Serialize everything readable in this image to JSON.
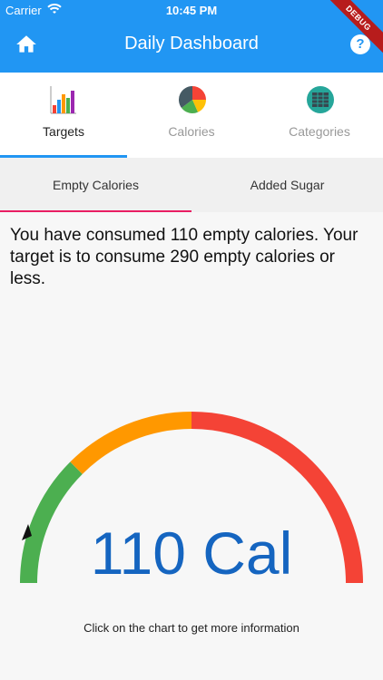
{
  "status": {
    "carrier": "Carrier",
    "time": "10:45 PM",
    "debug": "DEBUG"
  },
  "appbar": {
    "title": "Daily Dashboard",
    "help_label": "?"
  },
  "tabs": [
    {
      "label": "Targets",
      "icon": "bar-chart-icon"
    },
    {
      "label": "Calories",
      "icon": "pie-chart-icon"
    },
    {
      "label": "Categories",
      "icon": "grid-table-icon"
    }
  ],
  "subtabs": [
    {
      "label": "Empty Calories"
    },
    {
      "label": "Added Sugar"
    }
  ],
  "message": "You have consumed 110 empty calories. Your target is to consume 290 empty calories or less.",
  "gauge": {
    "value_text": "110 Cal",
    "hint": "Click on the chart to get more information"
  },
  "colors": {
    "primary": "#2196f3",
    "accent": "#e91e63",
    "green": "#4caf50",
    "orange": "#ff9800",
    "red": "#f44336",
    "value": "#1565c0"
  }
}
